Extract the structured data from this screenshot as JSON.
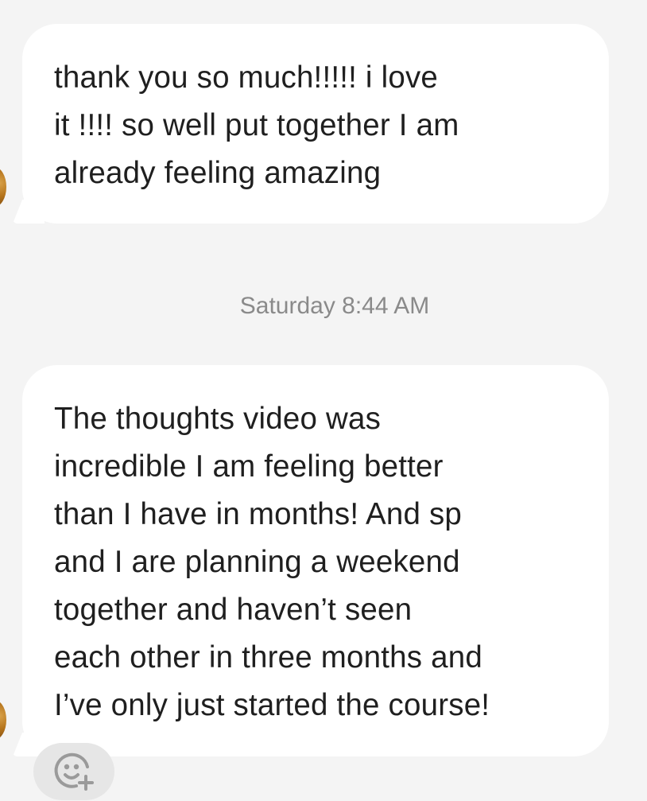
{
  "messages": [
    {
      "text": "thank you so much!!!!! i love\nit !!!! so well put together I am\nalready feeling amazing"
    },
    {
      "text": "The thoughts video was\nincredible  I am feeling better\nthan I have in months! And sp\nand I are planning a weekend\ntogether and haven’t seen\neach other in three months and\nI’ve only just started the course!"
    }
  ],
  "timestamp": "Saturday 8:44 AM",
  "reaction": {
    "icon": "add-reaction-icon"
  },
  "colors": {
    "background": "#f4f4f4",
    "bubble": "#ffffff",
    "text": "#1f1f1f",
    "timestamp": "#8a8a8a",
    "reaction_button": "#e6e6e6"
  }
}
